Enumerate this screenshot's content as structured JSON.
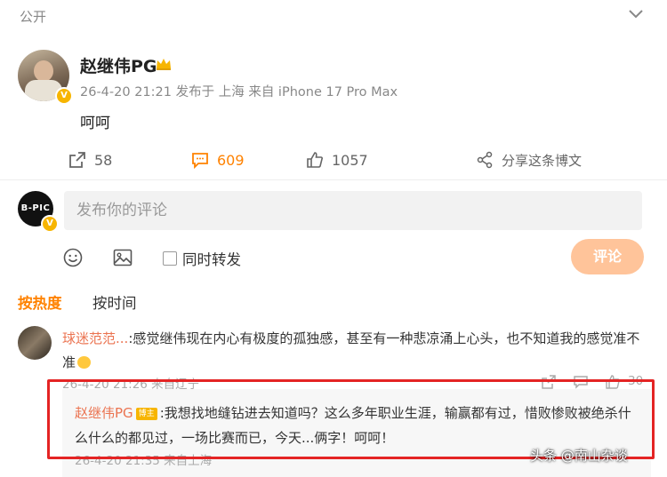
{
  "post": {
    "visibility": "公开",
    "author": "赵继伟PG",
    "meta": "26-4-20 21:21  发布于 上海  来自 iPhone 17 Pro Max",
    "content": "呵呵"
  },
  "actions": {
    "repost_count": "58",
    "comment_count": "609",
    "like_count": "1057",
    "share_label": "分享这条博文"
  },
  "composer": {
    "avatar_text": "B-PIC",
    "placeholder": "发布你的评论",
    "repost_label": "同时转发",
    "submit_label": "评论"
  },
  "sort": {
    "hot": "按热度",
    "time": "按时间"
  },
  "comment": {
    "author": "球迷范范...",
    "text": ":感觉继伟现在内心有极度的孤独感，甚至有一种悲凉涌上心头，也不知道我的感觉准不准",
    "meta": "26-4-20 21:26 来自辽宁",
    "like_count": "30"
  },
  "reply": {
    "author": "赵继伟PG",
    "tag": "博主",
    "text": ":我想找地缝钻进去知道吗？这么多年职业生涯，输赢都有过，惜败惨败被绝杀什么什么的都见过，一场比赛而已，今天...俩字！呵呵！",
    "meta": "26-4-20 21:35 来自上海"
  },
  "watermark": "头条 @南山杂谈",
  "colors": {
    "accent": "#ff8200",
    "name": "#eb7350",
    "highlight": "#e42424"
  }
}
